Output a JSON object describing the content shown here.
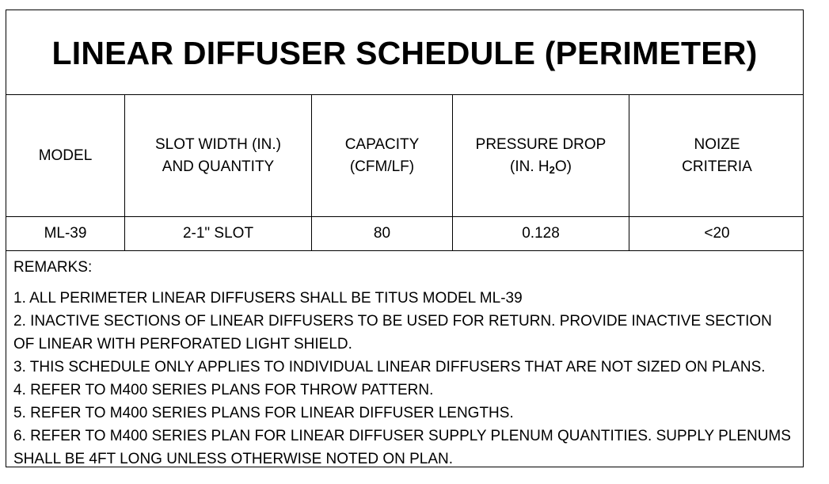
{
  "title": "LINEAR DIFFUSER SCHEDULE (PERIMETER)",
  "headers": {
    "model": "MODEL",
    "slot_line1": "SLOT WIDTH (IN.)",
    "slot_line2": "AND QUANTITY",
    "capacity_line1": "CAPACITY",
    "capacity_line2": "(CFM/LF)",
    "pressure_line1": "PRESSURE DROP",
    "pressure_pre": "(IN. H",
    "pressure_sub": "2",
    "pressure_post": "O)",
    "noise_line1": "NOIZE",
    "noise_line2": "CRITERIA"
  },
  "row": {
    "model": "ML-39",
    "slot": "2-1\" SLOT",
    "capacity": "80",
    "pressure": "0.128",
    "noise": "<20"
  },
  "remarks": {
    "title": "REMARKS:",
    "lines": [
      "1.   ALL PERIMETER LINEAR DIFFUSERS SHALL BE TITUS MODEL ML-39",
      "2.  INACTIVE SECTIONS OF LINEAR DIFFUSERS TO BE USED FOR RETURN. PROVIDE INACTIVE SECTION",
      "OF LINEAR WITH PERFORATED LIGHT SHIELD.",
      "3. THIS SCHEDULE ONLY APPLIES TO INDIVIDUAL LINEAR DIFFUSERS THAT ARE NOT SIZED ON PLANS.",
      "4. REFER TO M400 SERIES PLANS FOR THROW PATTERN.",
      "5. REFER TO M400 SERIES PLANS FOR LINEAR DIFFUSER LENGTHS.",
      "6. REFER TO M400 SERIES PLAN FOR LINEAR DIFFUSER SUPPLY PLENUM QUANTITIES. SUPPLY PLENUMS",
      "SHALL BE 4FT LONG UNLESS OTHERWISE NOTED ON PLAN."
    ]
  }
}
